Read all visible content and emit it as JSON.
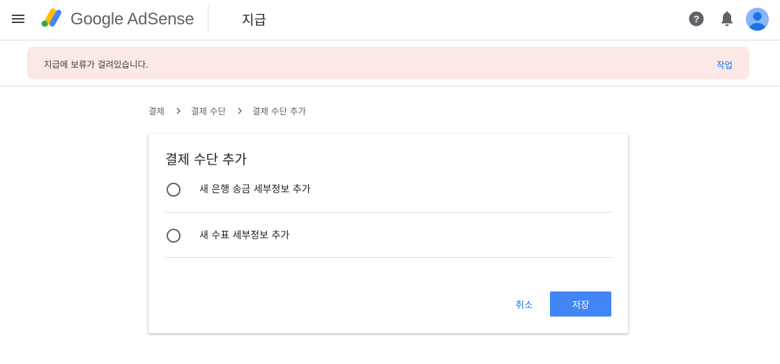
{
  "header": {
    "brand": "Google AdSense",
    "page_title": "지급",
    "icons": [
      "menu-icon",
      "adsense-logo",
      "help-icon",
      "bell-icon",
      "avatar"
    ]
  },
  "alert": {
    "message": "지급에 보류가 걸려있습니다.",
    "action": "작업"
  },
  "breadcrumb": [
    "결제",
    "결제 수단",
    "결제 수단 추가"
  ],
  "card": {
    "title": "결제 수단 추가",
    "options": [
      {
        "label": "새 은행 송금 세부정보 추가",
        "selected": false
      },
      {
        "label": "새 수표 세부정보 추가",
        "selected": false
      }
    ],
    "cancel_label": "취소",
    "save_label": "저장"
  },
  "colors": {
    "accent": "#1a73e8",
    "primary_button": "#4285f4",
    "alert_background": "#fce8e6",
    "logo_yellow": "#fbbc04",
    "logo_blue": "#4285f4",
    "logo_green": "#34a853",
    "avatar_bg": "#8ab4f8",
    "avatar_fg": "#1a73e8"
  }
}
